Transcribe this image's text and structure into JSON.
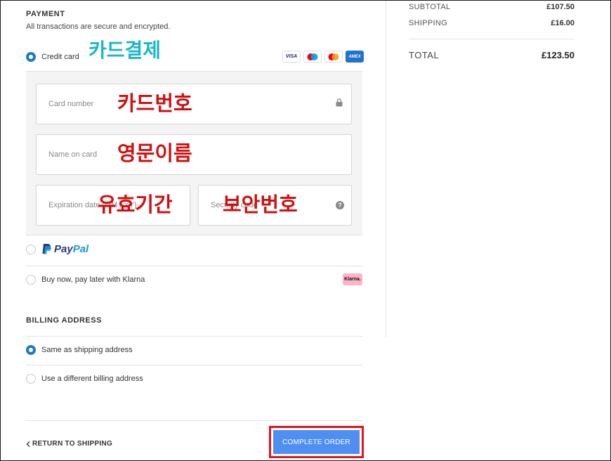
{
  "payment": {
    "title": "PAYMENT",
    "subtitle": "All transactions are secure and encrypted.",
    "credit_card_label": "Credit card",
    "annotation_method": "카드결제",
    "card_brands": [
      "VISA",
      "Maestro",
      "Mastercard",
      "AMEX"
    ],
    "fields": {
      "card_number_placeholder": "Card number",
      "name_placeholder": "Name on card",
      "expiration_placeholder": "Expiration date (MM / YY)",
      "security_placeholder": "Security code"
    },
    "annotations": {
      "card_number": "카드번호",
      "name": "영문이름",
      "expiration": "유효기간",
      "security": "보안번호"
    },
    "paypal": {
      "pay": "Pay",
      "pal": "Pal"
    },
    "klarna_label": "Buy now, pay later with Klarna",
    "klarna_badge": "Klarna."
  },
  "billing": {
    "title": "BILLING ADDRESS",
    "same_label": "Same as shipping address",
    "different_label": "Use a different billing address"
  },
  "footer": {
    "return_label": "RETURN TO SHIPPING",
    "complete_label": "COMPLETE ORDER"
  },
  "summary": {
    "subtotal_label": "SUBTOTAL",
    "subtotal_value": "£107.50",
    "shipping_label": "SHIPPING",
    "shipping_value": "£16.00",
    "total_label": "TOTAL",
    "total_value": "£123.50"
  },
  "colors": {
    "accent": "#1f7bc1",
    "button": "#4f8ff2",
    "highlight": "#e2141d",
    "annotation_teal": "#1bb6c8",
    "annotation_red": "#d01010"
  }
}
